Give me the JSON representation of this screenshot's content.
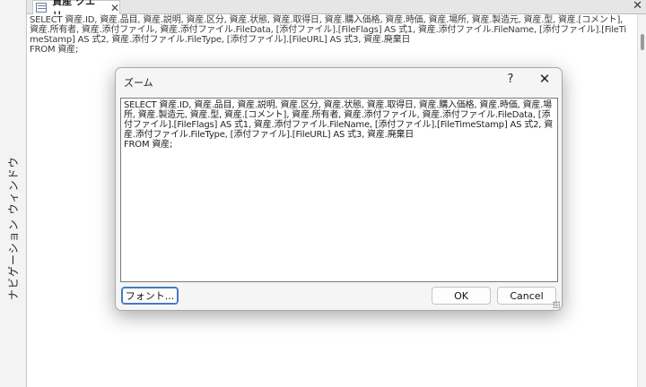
{
  "navigation_pane": {
    "label": "ナビゲーション ウィンドウ"
  },
  "tab": {
    "label": "資産 クエリ",
    "close": "✕"
  },
  "document": {
    "close": "✕",
    "sql": "SELECT 資産.ID, 資産.品目, 資産.説明, 資産.区分, 資産.状態, 資産.取得日, 資産.購入価格, 資産.時価, 資産.場所, 資産.製造元, 資産.型, 資産.[コメント], 資産.所有者, 資産.添付ファイル, 資産.添付ファイル.FileData, [添付ファイル].[FileFlags] AS 式1, 資産.添付ファイル.FileName, [添付ファイル].[FileTimeStamp] AS 式2, 資産.添付ファイル.FileType, [添付ファイル].[FileURL] AS 式3, 資産.廃棄日\nFROM 資産;"
  },
  "dialog": {
    "title": "ズーム",
    "help": "?",
    "close": "✕",
    "text": "SELECT 資産.ID, 資産.品目, 資産.説明, 資産.区分, 資産.状態, 資産.取得日, 資産.購入価格, 資産.時価, 資産.場所, 資産.製造元, 資産.型, 資産.[コメント], 資産.所有者, 資産.添付ファイル, 資産.添付ファイル.FileData, [添付ファイル].[FileFlags] AS 式1, 資産.添付ファイル.FileName, [添付ファイル].[FileTimeStamp] AS 式2, 資産.添付ファイル.FileType, [添付ファイル].[FileURL] AS 式3, 資産.廃棄日\nFROM 資産;",
    "font_button": "フォント...",
    "ok_button": "OK",
    "cancel_button": "Cancel"
  }
}
